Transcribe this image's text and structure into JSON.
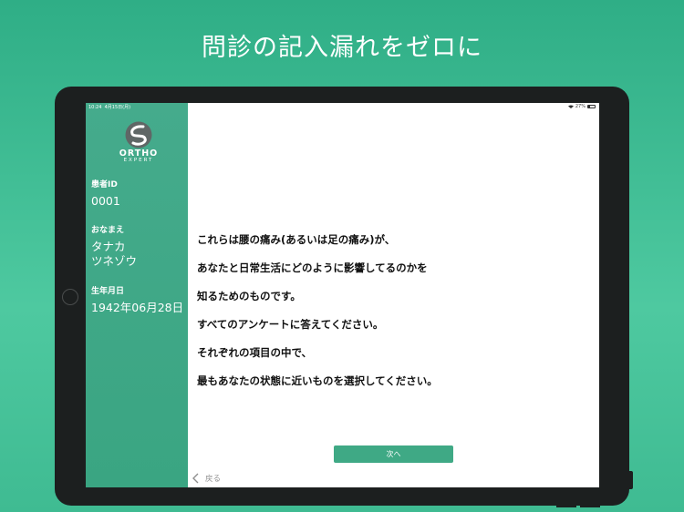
{
  "headline": "問診の記入漏れをゼロに",
  "status_bar": {
    "time": "10:24",
    "date": "4月15日(月)",
    "battery": "27%"
  },
  "logo": {
    "word": "ORTHO",
    "sub": "EXPERT"
  },
  "patient": {
    "id_label": "患者ID",
    "id_value": "0001",
    "name_label": "おなまえ",
    "name_line1": "タナカ",
    "name_line2": "ツネゾウ",
    "dob_label": "生年月日",
    "dob_value": "1942年06月28日"
  },
  "message": {
    "lines": [
      "これらは腰の痛み(あるいは足の痛み)が、",
      "あなたと日常生活にどのように影響してるのかを",
      "知るためのものです。",
      "すべてのアンケートに答えてください。",
      "それぞれの項目の中で、",
      "最もあなたの状態に近いものを選択してください。"
    ]
  },
  "buttons": {
    "next": "次へ",
    "back": "戻る"
  },
  "colors": {
    "background": "#3fbb92",
    "sidebar": "#45ab8c",
    "button": "#3fa985"
  }
}
